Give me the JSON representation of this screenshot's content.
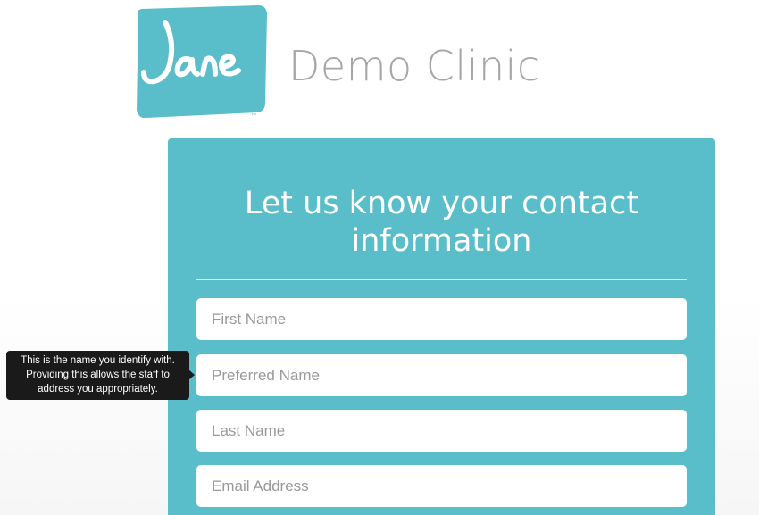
{
  "header": {
    "logo_text": "Jane",
    "clinic_name": "Demo Clinic"
  },
  "form": {
    "title_line1": "Let us know your contact",
    "title_line2": "information",
    "fields": [
      {
        "placeholder": "First Name",
        "value": ""
      },
      {
        "placeholder": "Preferred Name",
        "value": ""
      },
      {
        "placeholder": "Last Name",
        "value": ""
      },
      {
        "placeholder": "Email Address",
        "value": ""
      }
    ]
  },
  "tooltip": {
    "line1": "This is the name you identify with.",
    "line2": "Providing this allows the staff to",
    "line3": "address you appropriately."
  },
  "colors": {
    "brand_teal": "#59bec9",
    "clinic_name_gray": "#a6a6a6",
    "tooltip_bg": "#1a1a1a"
  }
}
